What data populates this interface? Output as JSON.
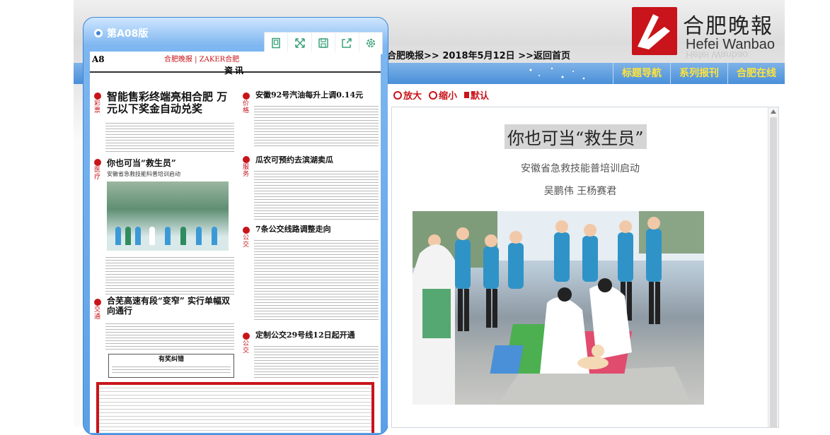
{
  "brand": {
    "logo_cn": "合肥晚報",
    "logo_en": "Hefei Wanbao",
    "colors": {
      "brand_red": "#c8141a",
      "nav_yellow": "#ffe33a",
      "nav_blue": "#4a8fd8"
    }
  },
  "breadcrumb": {
    "site": "合肥晚报",
    "sep1": ">>",
    "date": "2018年5月12日",
    "sep2": ">>",
    "home": "返回首页"
  },
  "nav": {
    "items": [
      {
        "label": "标题导航"
      },
      {
        "label": "系列报刊"
      },
      {
        "label": "合肥在线"
      }
    ]
  },
  "panel": {
    "title": "第A08版",
    "toolbar_icons": [
      "page-icon",
      "fullscreen-icon",
      "save-icon",
      "share-icon",
      "settings-icon"
    ]
  },
  "newspaper": {
    "page_no": "A8",
    "section": "资讯",
    "masthead": "合肥晚报 | ZAKER合肥",
    "left_headlines": [
      {
        "tag": "彩票",
        "text": "智能售彩终端亮相合肥 万元以下奖金自动兑奖"
      },
      {
        "tag": "医疗",
        "text": "你也可当“救生员”"
      },
      {
        "tag": "交通",
        "text": "合芜高速有段“变窄” 实行单幅双向通行"
      }
    ],
    "left_subheadline": "安徽省急救技能科普培训启动",
    "right_headlines": [
      {
        "tag": "价格",
        "text": "安徽92号汽油每升上调0.14元"
      },
      {
        "tag": "服务",
        "text": "瓜农可预约去滨湖卖瓜"
      },
      {
        "tag": "公交",
        "text": "7条公交线路调整走向"
      },
      {
        "tag": "公交",
        "text": "定制公交29号线12日起开通"
      }
    ],
    "notice_title": "有奖纠错"
  },
  "zoom": {
    "zoom_in": "放大",
    "zoom_out": "缩小",
    "default": "默认"
  },
  "article": {
    "title": "你也可当“救生员”",
    "subtitle": "安徽省急救技能普培训启动",
    "authors": "吴鹏伟 王杨赛君"
  }
}
